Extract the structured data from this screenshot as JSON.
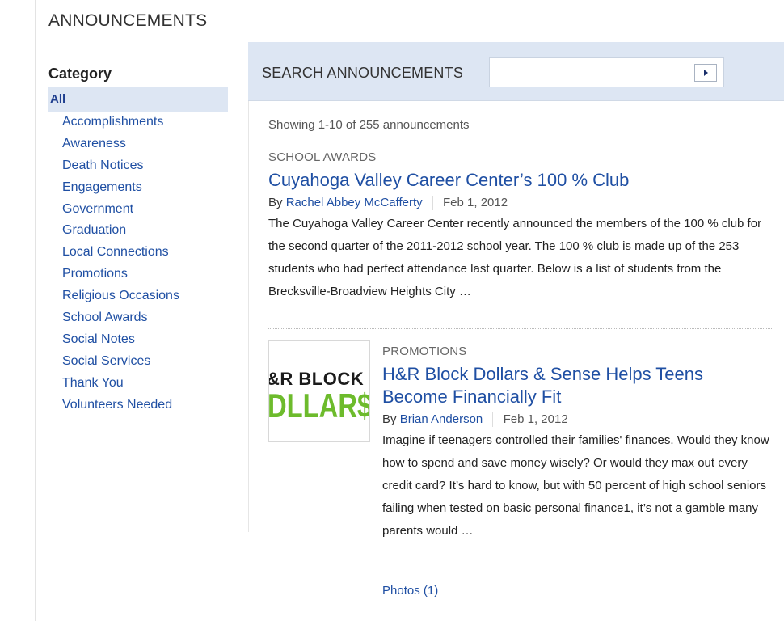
{
  "page": {
    "title": "ANNOUNCEMENTS"
  },
  "sidebar": {
    "heading": "Category",
    "selected": "All",
    "items": [
      "Accomplishments",
      "Awareness",
      "Death Notices",
      "Engagements",
      "Government",
      "Graduation",
      "Local Connections",
      "Promotions",
      "Religious Occasions",
      "School Awards",
      "Social Notes",
      "Social Services",
      "Thank You",
      "Volunteers Needed"
    ]
  },
  "search": {
    "label": "SEARCH ANNOUNCEMENTS",
    "value": "",
    "placeholder": "",
    "button_icon": "play-arrow-icon"
  },
  "results": {
    "summary": "Showing 1-10 of 255 announcements"
  },
  "articles": [
    {
      "category": "SCHOOL AWARDS",
      "title": "Cuyahoga Valley Career Center’s 100 % Club",
      "by": "By",
      "author": "Rachel Abbey McCafferty",
      "date": "Feb 1, 2012",
      "excerpt": "The Cuyahoga Valley Career Center recently announced the members of the 100 % club for the second quarter of the 2011-2012 school year. The 100 % club is made up of the 253 students who had perfect attendance last quarter.  Below is a list of students from the Brecksville-Broadview Heights City …"
    },
    {
      "category": "PROMOTIONS",
      "title": "H&R Block Dollars & Sense Helps Teens Become Financially Fit",
      "by": "By",
      "author": "Brian Anderson",
      "date": "Feb 1, 2012",
      "excerpt": "Imagine if teenagers controlled their families' finances. Would they know how to spend and save money wisely? Or would they max out every credit card? It’s hard to know, but with 50 percent of high school seniors failing when tested on basic personal finance1, it’s not a gamble many parents would …",
      "thumbnail": {
        "line1": "&R BLOCK",
        "line2": "DLLAR$ &"
      },
      "photos_link": "Photos (1)"
    }
  ],
  "colors": {
    "link": "#1f4fa3",
    "search_bar_bg": "#dde6f3",
    "selected_bg": "#dde6f3",
    "thumb_green": "#6dbb2c"
  }
}
